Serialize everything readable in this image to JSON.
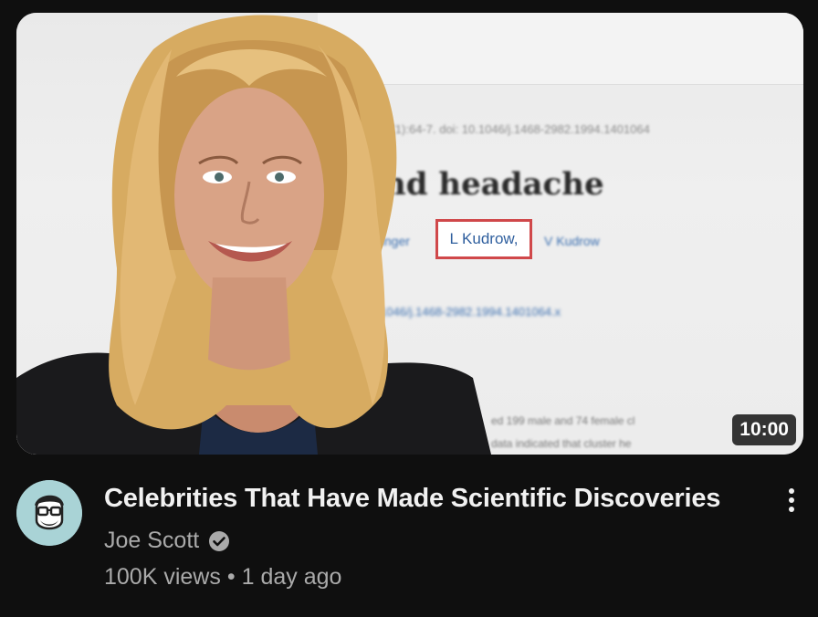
{
  "video": {
    "thumbnail": {
      "paper": {
        "citation_line": "Feb;14(1):64-7. doi: 10.1046/j.1468-2982.1994.1401064",
        "headline": "and headache",
        "authors_left": "essinger",
        "highlighted_author": "L Kudrow,",
        "authors_right": "V Kudrow",
        "doi_line": "10.1046/j.1468-2982.1994.1401064.x",
        "body_line_1": "ed 199 male and 74 female cl",
        "body_line_2": "data indicated that cluster he"
      },
      "duration": "10:00"
    },
    "title": "Celebrities That Have Made Scientific Discoveries",
    "channel": {
      "name": "Joe Scott",
      "verified_icon": "verified-check-icon"
    },
    "views": "100K views",
    "separator": "•",
    "published": "1 day ago",
    "menu_icon": "more-vert-icon"
  },
  "colors": {
    "background": "#0f0f0f",
    "title_text": "#f1f1f1",
    "secondary_text": "#aaaaaa",
    "avatar_bg": "#a9d3d6",
    "highlight_border": "#d0484a",
    "link_blue": "#3b6fb0"
  }
}
